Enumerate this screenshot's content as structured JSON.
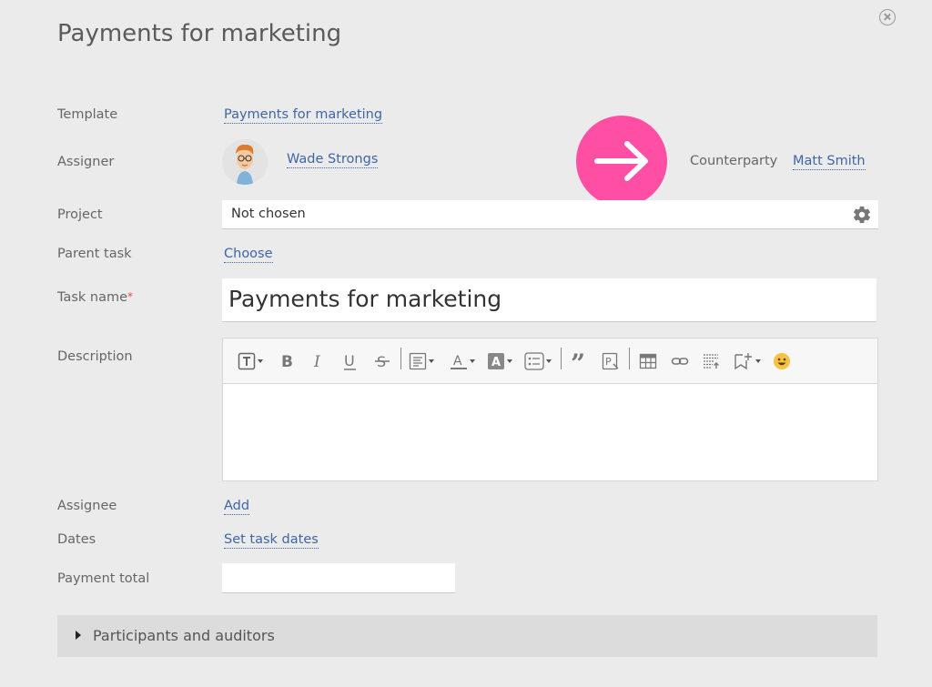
{
  "dialog": {
    "title": "Payments for marketing"
  },
  "fields": {
    "template": {
      "label": "Template",
      "value": "Payments for marketing"
    },
    "assigner": {
      "label": "Assigner",
      "name": "Wade Strongs"
    },
    "counterparty": {
      "label": "Counterparty",
      "name": "Matt Smith"
    },
    "project": {
      "label": "Project",
      "value": "Not chosen"
    },
    "parent_task": {
      "label": "Parent task",
      "action": "Choose"
    },
    "task_name": {
      "label": "Task name",
      "required_mark": "*",
      "value": "Payments for marketing"
    },
    "description": {
      "label": "Description",
      "value": ""
    },
    "assignee": {
      "label": "Assignee",
      "action": "Add"
    },
    "dates": {
      "label": "Dates",
      "action": "Set task dates"
    },
    "payment_total": {
      "label": "Payment total",
      "value": ""
    }
  },
  "editor_toolbar": {
    "buttons": [
      "text-format",
      "bold",
      "italic",
      "underline",
      "strikethrough",
      "paragraph",
      "font-color",
      "background-color",
      "list",
      "quote",
      "insert-form",
      "table",
      "link",
      "embed",
      "bookmark",
      "emoji"
    ]
  },
  "participants": {
    "label": "Participants and auditors"
  },
  "colors": {
    "accent_link": "#3e66a6",
    "action_button": "#ff4fa5",
    "required": "#e54b4b"
  }
}
